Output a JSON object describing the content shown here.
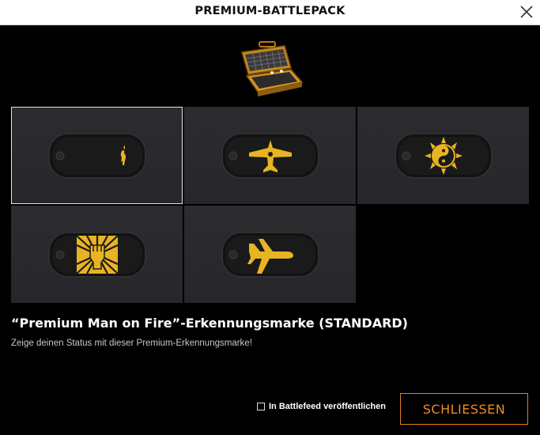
{
  "window": {
    "title": "PREMIUM-BATTLEPACK",
    "close_icon": "close-icon"
  },
  "pack": {
    "icon": "battlepack-case-icon",
    "items": [
      {
        "emblem": "flame-figure-icon",
        "selected": true
      },
      {
        "emblem": "fighter-jet-icon",
        "selected": false
      },
      {
        "emblem": "sun-yin-yang-icon",
        "selected": false
      },
      {
        "emblem": "raised-fist-icon",
        "selected": false
      },
      {
        "emblem": "airliner-icon",
        "selected": false
      }
    ]
  },
  "details": {
    "title": "“Premium Man on Fire”-Erkennungsmarke (STANDARD)",
    "description": "Zeige deinen Status mit dieser Premium-Erkennungsmarke!"
  },
  "footer": {
    "share_label": "In Battlefeed veröffentlichen",
    "share_checked": false,
    "close_button": "SCHLIESSEN"
  },
  "colors": {
    "accent": "#f08a24",
    "emblem_gold": "#e8b423",
    "tile_bg": "#2a2a2e",
    "background": "#000000"
  }
}
